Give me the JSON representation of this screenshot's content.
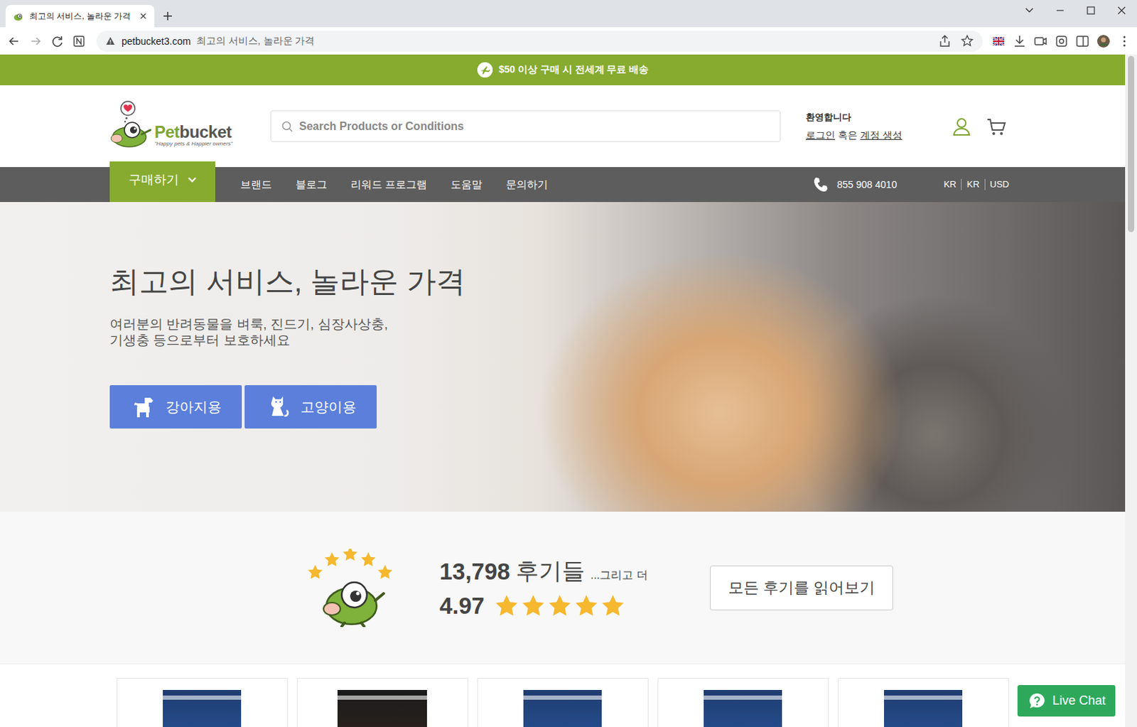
{
  "browser": {
    "tab": {
      "title": "최고의 서비스, 놀라운 가격",
      "selected": true
    },
    "url": {
      "domain": "petbucket3.com",
      "title": "최고의 서비스, 놀라운 가격"
    }
  },
  "banner": {
    "text": "$50 이상 구매 시 전세계 무료 배송"
  },
  "logo": {
    "prefix": "Pet",
    "suffix": "bucket",
    "tagline": "\"Happy pets & Happier owners\""
  },
  "search": {
    "placeholder": "Search Products or Conditions"
  },
  "account": {
    "welcome": "환영합니다",
    "login": "로그인",
    "or": "혹은",
    "signup": "계정 생성"
  },
  "nav": {
    "shop": "구매하기",
    "items": [
      "브랜드",
      "블로그",
      "리워드 프로그램",
      "도움말",
      "문의하기"
    ],
    "phone": "855 908 4010",
    "locale": [
      "KR",
      "KR",
      "USD"
    ]
  },
  "hero": {
    "title": "최고의 서비스, 놀라운 가격",
    "subtitle": "여러분의 반려동물을 벼룩, 진드기, 심장사상충, 기생충 등으로부터 보호하세요",
    "buttons": [
      {
        "label": "강아지용",
        "kind": "dog"
      },
      {
        "label": "고양이용",
        "kind": "cat"
      }
    ]
  },
  "reviews": {
    "count": "13,798",
    "label": "후기들",
    "more": "...그리고 더",
    "rating": "4.97",
    "stars": 5,
    "button": "모든 후기를 읽어보기"
  },
  "products": [
    {
      "kind": "nexgard"
    },
    {
      "kind": "heartgard"
    },
    {
      "kind": "nexgard"
    },
    {
      "kind": "nexgard"
    },
    {
      "kind": "nexgard"
    }
  ],
  "chat": {
    "label": "Live Chat"
  }
}
